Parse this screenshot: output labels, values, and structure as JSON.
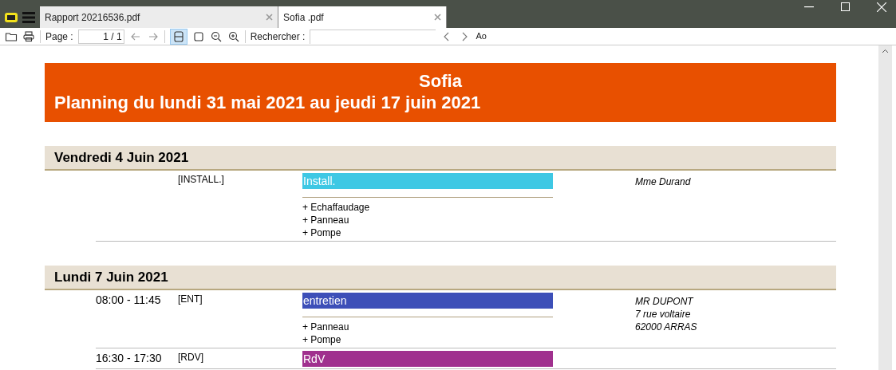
{
  "tabs": [
    {
      "label": "Rapport 20216536.pdf",
      "selected": false
    },
    {
      "label": "Sofia .pdf",
      "selected": true
    }
  ],
  "toolbar": {
    "page_label": "Page :",
    "page_value": "1 / 1",
    "search_label": "Rechercher :",
    "case_label": "Ao"
  },
  "document": {
    "title": "Sofia",
    "subtitle": "Planning du lundi 31 mai 2021 au jeudi 17 juin 2021",
    "days": [
      {
        "date": "Vendredi 4 Juin 2021",
        "entries": [
          {
            "code": "[INSTALL.]",
            "label": "Install.",
            "color": "#3ec8e4",
            "items": [
              "+ Echaffaudage",
              "+ Panneau",
              "+ Pompe"
            ],
            "client": [
              "Mme Durand"
            ]
          }
        ]
      },
      {
        "date": "Lundi 7 Juin 2021",
        "entries": [
          {
            "time": "08:00 - 11:45",
            "code": "[ENT]",
            "label": "entretien",
            "color": "#3d4fb8",
            "items": [
              "+ Panneau",
              "+ Pompe"
            ],
            "client": [
              "MR DUPONT",
              "7 rue voltaire",
              "62000 ARRAS"
            ]
          },
          {
            "time": "16:30 - 17:30",
            "code": "[RDV]",
            "label": "RdV",
            "color": "#a0308e"
          }
        ]
      }
    ]
  }
}
